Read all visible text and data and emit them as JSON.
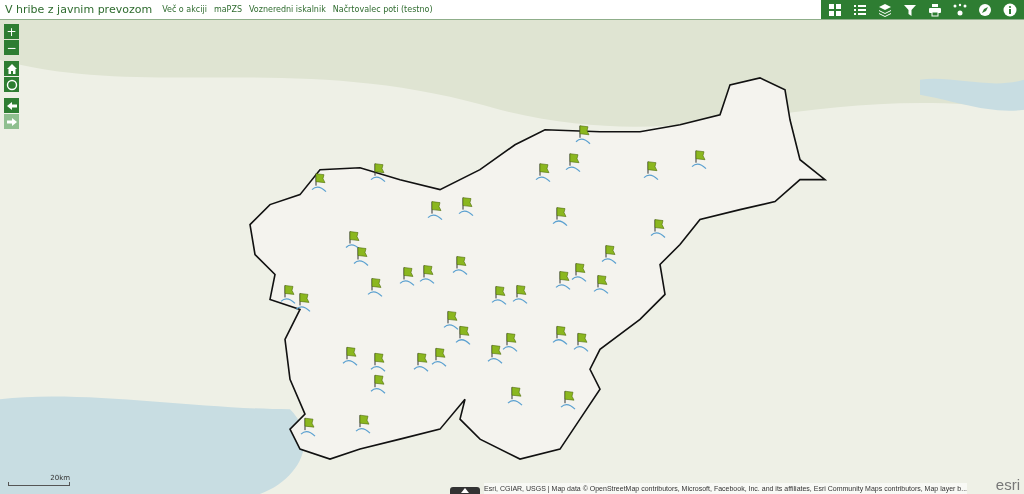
{
  "header": {
    "title": "V hribe z javnim prevozom",
    "links": [
      "Več o akciji",
      "maPZS",
      "Vozneredni iskalnik",
      "Načrtovalec poti (testno)"
    ],
    "tools": [
      {
        "kind": "grid"
      },
      {
        "kind": "list"
      },
      {
        "kind": "layers"
      },
      {
        "kind": "filter"
      },
      {
        "kind": "print"
      },
      {
        "kind": "share"
      },
      {
        "kind": "compass"
      },
      {
        "kind": "info"
      }
    ]
  },
  "map_controls": {
    "zoom_in": "+",
    "zoom_out": "−",
    "nav": [
      {
        "kind": "home",
        "disabled": false
      },
      {
        "kind": "locate",
        "disabled": false
      },
      {
        "kind": "back",
        "disabled": false
      },
      {
        "kind": "forward",
        "disabled": true
      }
    ]
  },
  "scale": {
    "label": "20km"
  },
  "footer": {
    "attribution": "Esri, CGIAR, USGS | Map data © OpenStreetMap contributors, Microsoft, Facebook, Inc. and its affiliates, Esri Community Maps contributors, Map layer b...",
    "logo": "esri"
  }
}
